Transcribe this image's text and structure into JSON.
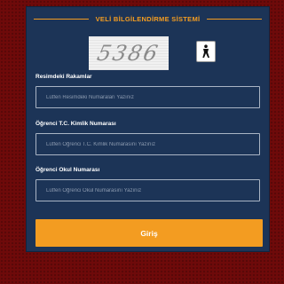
{
  "header": {
    "title": "VELİ BİLGİLENDİRME SİSTEMİ"
  },
  "captcha": {
    "text": "5386",
    "audio_icon": "accessibility-icon"
  },
  "fields": [
    {
      "label": "Resimdeki Rakamlar",
      "placeholder": "Lütfen Resimdeki Numaraları Yazınız",
      "value": ""
    },
    {
      "label": "Öğrenci T.C. Kimlik Numarası",
      "placeholder": "Lütfen Öğrenci T.C. Kimlik Numarasını Yazınız",
      "value": ""
    },
    {
      "label": "Öğrenci Okul Numarası",
      "placeholder": "Lütfen Öğrenci Okul Numarasını Yazınız",
      "value": ""
    }
  ],
  "submit": {
    "label": "Giriş"
  },
  "colors": {
    "accent": "#f39c21",
    "panel": "#1c3457",
    "background": "#6e0a0a"
  }
}
